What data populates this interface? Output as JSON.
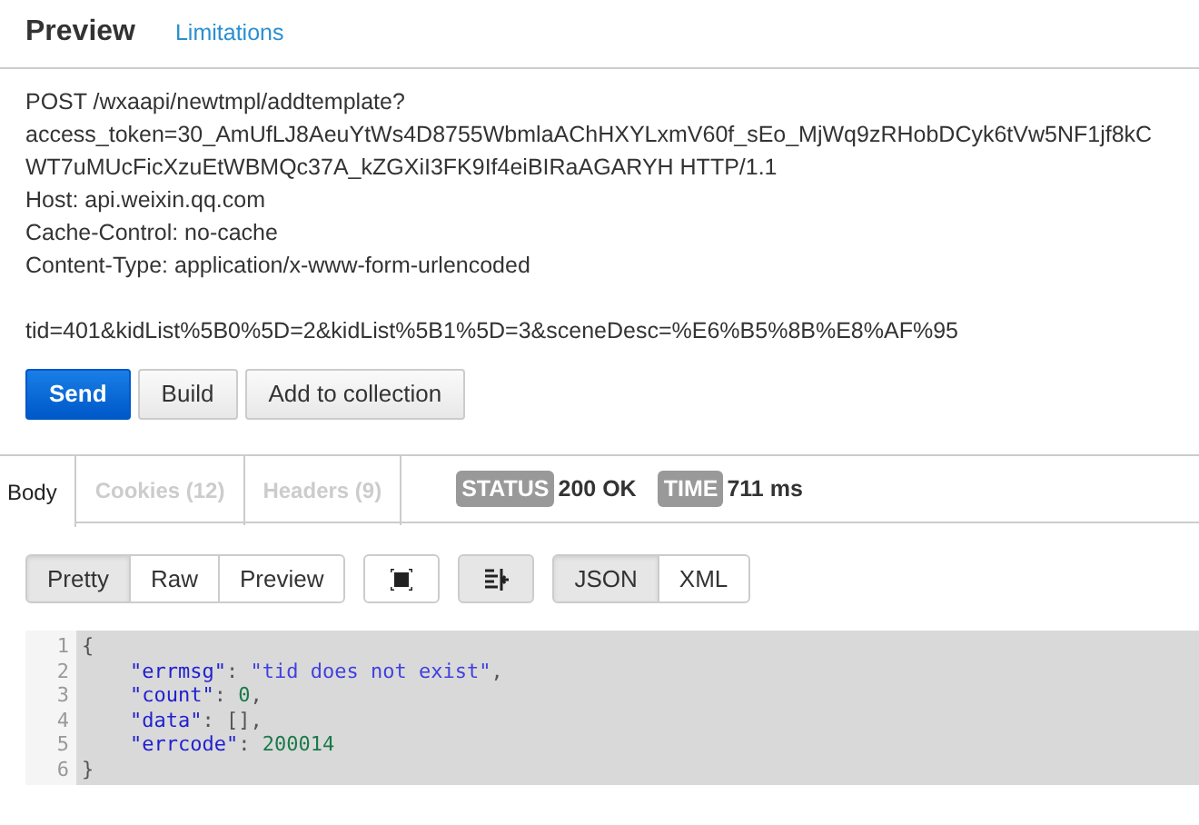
{
  "header": {
    "title": "Preview",
    "link": "Limitations"
  },
  "request_lines": [
    "POST /wxaapi/newtmpl/addtemplate?",
    "access_token=30_AmUfLJ8AeuYtWs4D8755WbmlaAChHXYLxmV60f_sEo_MjWq9zRHobDCyk6tVw5NF1jf8kC",
    "WT7uMUcFicXzuEtWBMQc37A_kZGXiI3FK9If4eiBIRaAGARYH HTTP/1.1",
    "Host: api.weixin.qq.com",
    "Cache-Control: no-cache",
    "Content-Type: application/x-www-form-urlencoded"
  ],
  "request_body": [
    "tid=401&kidList%5B0%5D=2&kidList%5B1%5D=3&sceneDesc=%E6%B5%8B%E8%AF%95"
  ],
  "actions": [
    {
      "label": "Send",
      "kind": "primary"
    },
    {
      "label": "Build",
      "kind": "default"
    },
    {
      "label": "Add to collection",
      "kind": "default"
    }
  ],
  "response_tabs": [
    {
      "label": "Body",
      "selected": true
    },
    {
      "label": "Cookies (12)",
      "selected": false
    },
    {
      "label": "Headers (9)",
      "selected": false
    }
  ],
  "status": {
    "label": "STATUS",
    "value": "200 OK"
  },
  "time": {
    "label": "TIME",
    "value": "711 ms"
  },
  "view_modes": [
    {
      "label": "Pretty",
      "selected": true
    },
    {
      "label": "Raw",
      "selected": false
    },
    {
      "label": "Preview",
      "selected": false
    }
  ],
  "wrap_selected": true,
  "formats": [
    {
      "label": "JSON",
      "selected": true
    },
    {
      "label": "XML",
      "selected": false
    }
  ],
  "code_lines": [
    {
      "number": "1",
      "tokens": [
        {
          "kind": "punct",
          "text": "{"
        }
      ]
    },
    {
      "number": "2",
      "tokens": [
        {
          "kind": "key",
          "text": "    \"errmsg\""
        },
        {
          "kind": "punct",
          "text": ": "
        },
        {
          "kind": "string",
          "text": "\"tid does not exist\""
        },
        {
          "kind": "punct",
          "text": ","
        }
      ]
    },
    {
      "number": "3",
      "tokens": [
        {
          "kind": "key",
          "text": "    \"count\""
        },
        {
          "kind": "punct",
          "text": ": "
        },
        {
          "kind": "number",
          "text": "0"
        },
        {
          "kind": "punct",
          "text": ","
        }
      ]
    },
    {
      "number": "4",
      "tokens": [
        {
          "kind": "key",
          "text": "    \"data\""
        },
        {
          "kind": "punct",
          "text": ": [],"
        }
      ]
    },
    {
      "number": "5",
      "tokens": [
        {
          "kind": "key",
          "text": "    \"errcode\""
        },
        {
          "kind": "punct",
          "text": ": "
        },
        {
          "kind": "number",
          "text": "200014"
        }
      ]
    },
    {
      "number": "6",
      "tokens": [
        {
          "kind": "punct",
          "text": "}"
        }
      ]
    }
  ]
}
